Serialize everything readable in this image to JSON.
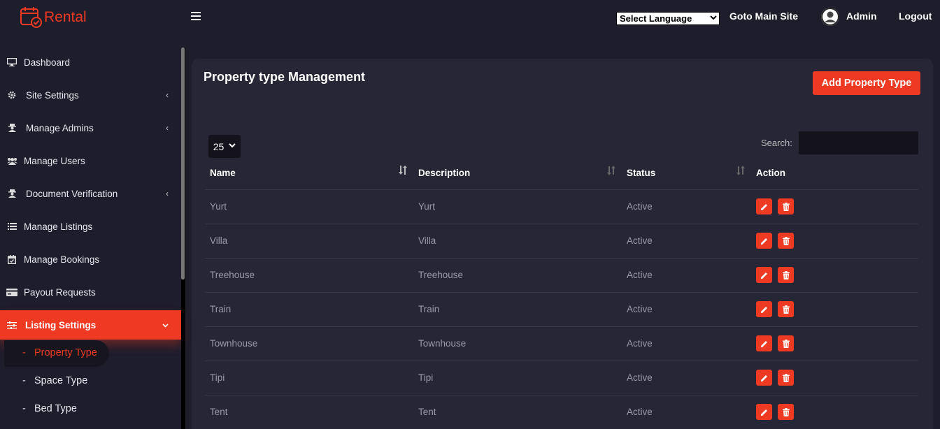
{
  "brand": {
    "name": "Rental",
    "accent": "#ee3a22"
  },
  "topbar": {
    "language_select": "Select Language",
    "main_site_link": "Goto Main Site",
    "user_name": "Admin",
    "logout": "Logout"
  },
  "sidebar": {
    "items": [
      {
        "label": "Dashboard",
        "icon": "monitor-icon",
        "has_arrow": false
      },
      {
        "label": "Site Settings",
        "icon": "gear-icon",
        "has_arrow": true
      },
      {
        "label": "Manage Admins",
        "icon": "user-secret-icon",
        "has_arrow": true
      },
      {
        "label": "Manage Users",
        "icon": "users-icon",
        "has_arrow": false
      },
      {
        "label": "Document Verification",
        "icon": "user-secret-icon",
        "has_arrow": true
      },
      {
        "label": "Manage Listings",
        "icon": "list-icon",
        "has_arrow": false
      },
      {
        "label": "Manage Bookings",
        "icon": "calendar-check-icon",
        "has_arrow": false
      },
      {
        "label": "Payout Requests",
        "icon": "credit-card-icon",
        "has_arrow": false
      },
      {
        "label": "Listing Settings",
        "icon": "sliders-icon",
        "has_arrow": true,
        "active": true
      }
    ],
    "subitems": [
      {
        "label": "Property Type",
        "active": true
      },
      {
        "label": "Space Type"
      },
      {
        "label": "Bed Type"
      }
    ],
    "arrow_collapsed": "‹",
    "arrow_expanded": "⌄",
    "sub_dash": "-"
  },
  "main": {
    "title": "Property type Management",
    "add_button": "Add Property Type",
    "page_length": "25",
    "search_label": "Search:",
    "search_value": "",
    "columns": [
      "Name",
      "Description",
      "Status",
      "Action"
    ],
    "rows": [
      {
        "name": "Yurt",
        "description": "Yurt",
        "status": "Active"
      },
      {
        "name": "Villa",
        "description": "Villa",
        "status": "Active"
      },
      {
        "name": "Treehouse",
        "description": "Treehouse",
        "status": "Active"
      },
      {
        "name": "Train",
        "description": "Train",
        "status": "Active"
      },
      {
        "name": "Townhouse",
        "description": "Townhouse",
        "status": "Active"
      },
      {
        "name": "Tipi",
        "description": "Tipi",
        "status": "Active"
      },
      {
        "name": "Tent",
        "description": "Tent",
        "status": "Active"
      }
    ]
  }
}
